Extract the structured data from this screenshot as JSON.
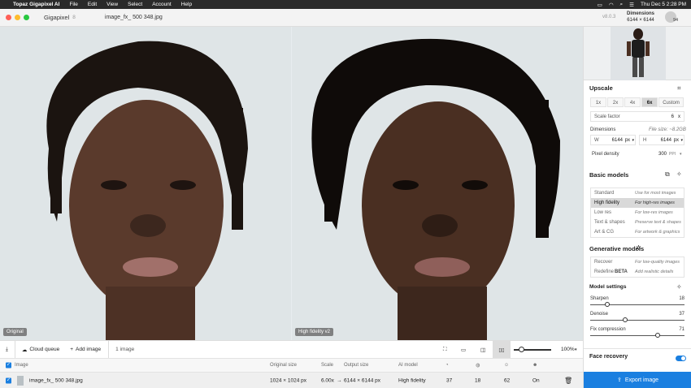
{
  "menubar": {
    "app": "Topaz Gigapixel AI",
    "items": [
      "File",
      "Edit",
      "View",
      "Select",
      "Account",
      "Help"
    ],
    "clock": "Thu Dec 5  2:28 PM"
  },
  "titlebar": {
    "app_name": "Gigapixel",
    "app_version_badge": "8",
    "file_name": "image_fx_ 500 348.jpg",
    "version": "v8.0.3",
    "dims_label": "Dimensions",
    "dims_value": "6144 × 6144",
    "credits": "94"
  },
  "preview": {
    "left_label": "Original",
    "right_label": "High fidelity v2"
  },
  "toolbar": {
    "cloud_queue": "Cloud queue",
    "add_image": "Add image",
    "image_count": "1 image",
    "zoom": "100%"
  },
  "queue": {
    "headers": {
      "image": "Image",
      "original_size": "Original size",
      "scale": "Scale",
      "output_size": "Output size",
      "ai_model": "AI model"
    },
    "row": {
      "name": "image_fx_ 500 348.jpg",
      "original_size": "1024 × 1024 px",
      "scale": "6.00x",
      "arrow": "→",
      "output_size": "6144 × 6144 px",
      "ai_model": "High fidelity",
      "sharpen": "37",
      "denoise": "18",
      "fix_compression": "62",
      "face_recovery": "On"
    }
  },
  "panel": {
    "upscale_title": "Upscale",
    "scale_options": [
      "1x",
      "2x",
      "4x",
      "6x",
      "Custom"
    ],
    "scale_factor_label": "Scale factor",
    "scale_factor_value": "6",
    "scale_factor_unit": "x",
    "dimensions_label": "Dimensions",
    "file_size": "File size: ~8.2GB",
    "width_label": "W",
    "width_value": "6144",
    "width_unit": "px",
    "height_label": "H",
    "height_value": "6144",
    "height_unit": "px",
    "pixel_density_label": "Pixel density",
    "pixel_density_value": "300",
    "pixel_density_unit": "PPI",
    "basic_models_title": "Basic models",
    "basic_models": [
      {
        "name": "Standard",
        "desc": "Use for most images"
      },
      {
        "name": "High fidelity",
        "desc": "For high-res images"
      },
      {
        "name": "Low res",
        "desc": "For low-res images"
      },
      {
        "name": "Text & shapes",
        "desc": "Preserve text & shapes"
      },
      {
        "name": "Art & CG",
        "desc": "For artwork & graphics"
      }
    ],
    "generative_title": "Generative models",
    "generative_models": [
      {
        "name": "Recover",
        "desc": "For low-quality images"
      },
      {
        "name": "Redefine",
        "badge": "BETA",
        "desc": "Add realistic details"
      }
    ],
    "model_settings_title": "Model settings",
    "sharpen_label": "Sharpen",
    "sharpen_value": "18",
    "denoise_label": "Denoise",
    "denoise_value": "37",
    "fixcomp_label": "Fix compression",
    "fixcomp_value": "71",
    "face_recovery_title": "Face recovery",
    "export_label": "Export image"
  },
  "colors": {
    "accent": "#1a7fe0",
    "menubar": "#2a2a2a"
  }
}
